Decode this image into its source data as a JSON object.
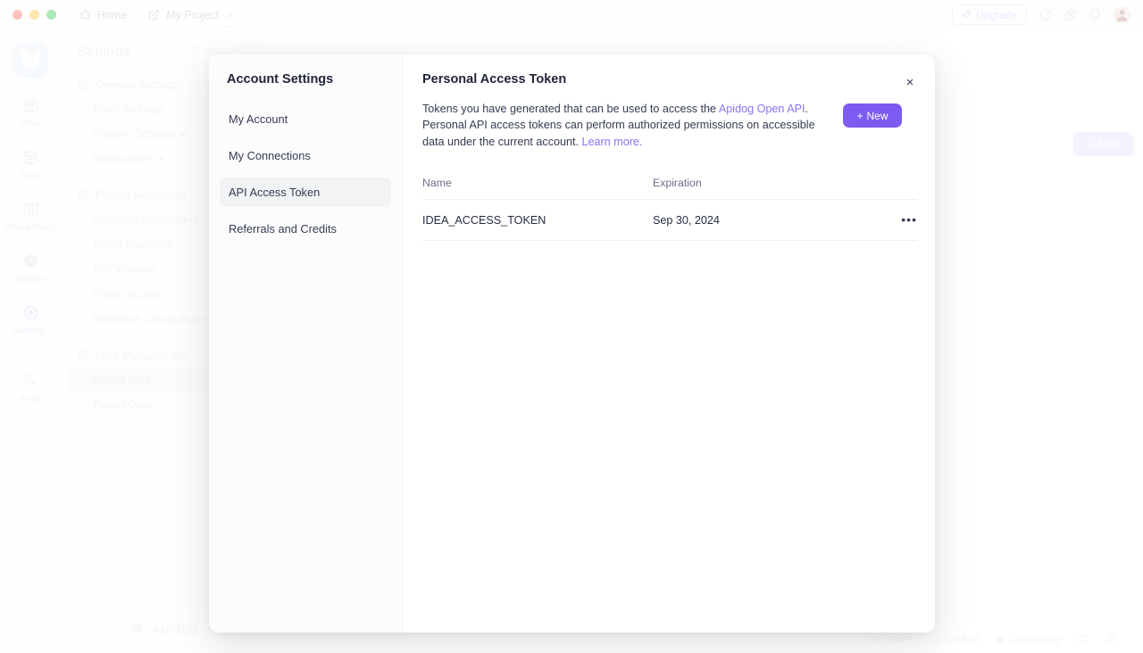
{
  "titlebar": {
    "tabs": [
      {
        "label": "Home",
        "icon": "home-icon",
        "active": false,
        "closable": false
      },
      {
        "label": "My Project",
        "icon": "external-link-icon",
        "active": true,
        "closable": true,
        "close_glyph": "×"
      }
    ],
    "upgrade_label": "Upgrade",
    "upgrade_icon": "rocket-icon",
    "icons": [
      "refresh-icon",
      "gear-icon",
      "bell-icon"
    ],
    "avatar": "user-avatar"
  },
  "rail": {
    "workspace_avatar": "dog-avatar",
    "items": [
      {
        "label": "APIs",
        "icon": "apis-icon",
        "active": false
      },
      {
        "label": "Tests",
        "icon": "tests-icon",
        "active": false
      },
      {
        "label": "Share Docs",
        "icon": "share-docs-icon",
        "active": false
      },
      {
        "label": "History",
        "icon": "history-clock-icon",
        "active": false
      },
      {
        "label": "Settings",
        "icon": "settings-circle-icon",
        "active": true
      },
      {
        "label": "Invite",
        "icon": "invite-user-icon",
        "active": false
      }
    ]
  },
  "sidebar": {
    "title": "Settings",
    "branch": {
      "label": "main",
      "icon": "branch-icon",
      "chevron": "⌄"
    },
    "groups": [
      {
        "label": "General Settings",
        "icon": "gear-icon",
        "items": [
          {
            "label": "Basic Settings",
            "caret": "",
            "selected": false
          },
          {
            "label": "Feature Settings",
            "caret": "▶",
            "selected": false
          },
          {
            "label": "Notifications",
            "caret": "▶",
            "selected": false
          }
        ]
      },
      {
        "label": "Project Resources",
        "icon": "layers-icon",
        "items": [
          {
            "label": "Common Parameters",
            "caret": "",
            "selected": false
          },
          {
            "label": "Sprint Branches",
            "caret": "",
            "selected": false
          },
          {
            "label": "API Versions",
            "caret": "",
            "selected": false
          },
          {
            "label": "Public Scripts",
            "caret": "",
            "selected": false
          },
          {
            "label": "Database Connections",
            "caret": "",
            "selected": false
          }
        ]
      },
      {
        "label": "Data Management",
        "icon": "database-icon",
        "items": [
          {
            "label": "Import Data",
            "caret": "",
            "selected": true
          },
          {
            "label": "Export Data",
            "caret": "",
            "selected": false
          }
        ]
      }
    ],
    "brand": "Apidog"
  },
  "main": {
    "new_button": {
      "label": "New",
      "plus": "+"
    }
  },
  "statusbar": {
    "items": [
      {
        "label": "Online",
        "icon": "online-check-icon"
      },
      {
        "label": "Cookies",
        "icon": "cookie-icon"
      },
      {
        "label": "Community",
        "icon": "community-bubble-icon"
      }
    ],
    "trailing_icons": [
      "trash-icon",
      "help-circle-icon"
    ]
  },
  "modal": {
    "nav_title": "Account Settings",
    "nav_items": [
      {
        "label": "My Account",
        "active": false
      },
      {
        "label": "My Connections",
        "active": false
      },
      {
        "label": "API Access Token",
        "active": true
      },
      {
        "label": "Referrals and Credits",
        "active": false
      }
    ],
    "title": "Personal Access Token",
    "close_glyph": "×",
    "description": {
      "part1": "Tokens you have generated that can be used to access the ",
      "link1": "Apidog Open API",
      "part2": ". Personal API access tokens can perform authorized permissions on accessible data under the current account. ",
      "link2": "Learn more."
    },
    "new_button": {
      "label": "New",
      "plus": "+"
    },
    "table": {
      "columns": [
        "Name",
        "Expiration",
        ""
      ],
      "rows": [
        {
          "name": "IDEA_ACCESS_TOKEN",
          "expiration": "Sep 30, 2024",
          "menu": "•••"
        }
      ]
    }
  },
  "colors": {
    "accent_purple": "#7c5cf0",
    "link_purple": "#8b73f0",
    "text_dark": "#1f2437",
    "text_muted": "#6a7084"
  }
}
